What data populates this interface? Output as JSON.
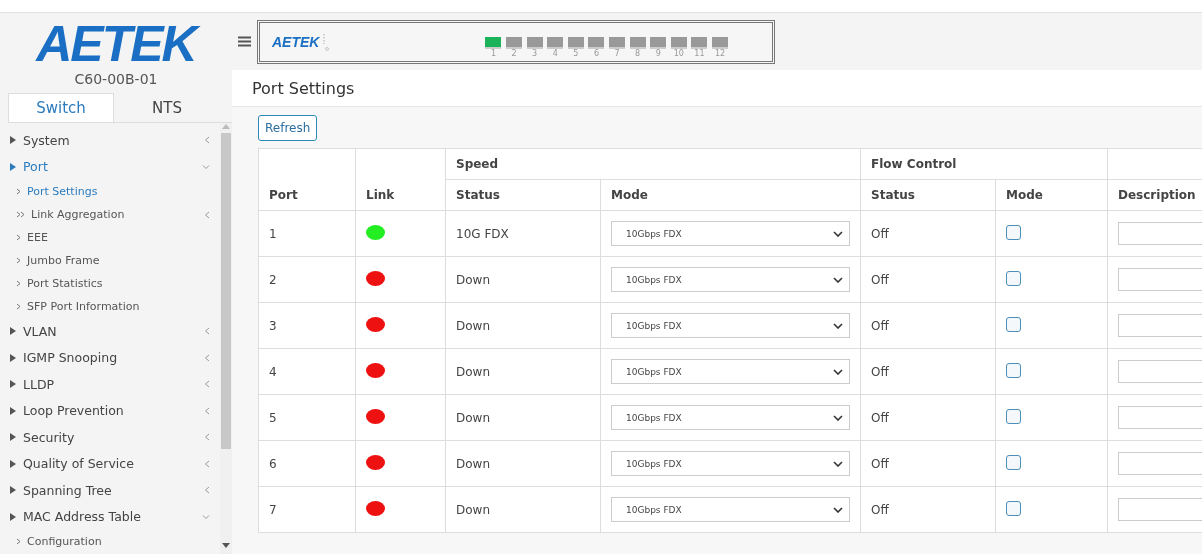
{
  "logo": "AETEK",
  "model": "C60-00B-01",
  "tabs": [
    {
      "label": "Switch",
      "selected": true
    },
    {
      "label": "NTS",
      "selected": false
    }
  ],
  "menu": [
    {
      "label": "System",
      "expanded": false,
      "selected": false
    },
    {
      "label": "Port",
      "expanded": true,
      "selected": true,
      "children": [
        {
          "label": "Port Settings",
          "selected": true
        },
        {
          "label": "Link Aggregation",
          "selected": false,
          "expanded": false
        },
        {
          "label": "EEE",
          "selected": false
        },
        {
          "label": "Jumbo Frame",
          "selected": false
        },
        {
          "label": "Port Statistics",
          "selected": false
        },
        {
          "label": "SFP Port Information",
          "selected": false
        }
      ]
    },
    {
      "label": "VLAN",
      "expanded": false,
      "selected": false
    },
    {
      "label": "IGMP Snooping",
      "expanded": false,
      "selected": false
    },
    {
      "label": "LLDP",
      "expanded": false,
      "selected": false
    },
    {
      "label": "Loop Prevention",
      "expanded": false,
      "selected": false
    },
    {
      "label": "Security",
      "expanded": false,
      "selected": false
    },
    {
      "label": "Quality of Service",
      "expanded": false,
      "selected": false
    },
    {
      "label": "Spanning Tree",
      "expanded": false,
      "selected": false
    },
    {
      "label": "MAC Address Table",
      "expanded": true,
      "selected": false,
      "children": [
        {
          "label": "Configuration",
          "selected": false
        }
      ]
    }
  ],
  "device": {
    "logo": "AETEK",
    "ports": [
      {
        "label": "1",
        "on": true
      },
      {
        "label": "2",
        "on": false
      },
      {
        "label": "3",
        "on": false
      },
      {
        "label": "4",
        "on": false
      },
      {
        "label": "5",
        "on": false
      },
      {
        "label": "6",
        "on": false
      },
      {
        "label": "7",
        "on": false
      },
      {
        "label": "8",
        "on": false
      },
      {
        "label": "9",
        "on": false
      },
      {
        "label": "10",
        "on": false
      },
      {
        "label": "11",
        "on": false
      },
      {
        "label": "12",
        "on": false
      }
    ]
  },
  "page": {
    "title": "Port Settings",
    "refresh": "Refresh"
  },
  "table": {
    "group_headers": [
      "Speed",
      "Flow Control"
    ],
    "columns": [
      "Port",
      "Link",
      "Status",
      "Mode",
      "Status",
      "Mode",
      "Description"
    ],
    "rows": [
      {
        "port": "1",
        "color": "#22ee22",
        "speed_status": "10G FDX",
        "speed_mode": "10Gbps FDX",
        "fc_status": "Off",
        "fc_mode": false
      },
      {
        "port": "2",
        "color": "#ee1111",
        "speed_status": "Down",
        "speed_mode": "10Gbps FDX",
        "fc_status": "Off",
        "fc_mode": false
      },
      {
        "port": "3",
        "color": "#ee1111",
        "speed_status": "Down",
        "speed_mode": "10Gbps FDX",
        "fc_status": "Off",
        "fc_mode": false
      },
      {
        "port": "4",
        "color": "#ee1111",
        "speed_status": "Down",
        "speed_mode": "10Gbps FDX",
        "fc_status": "Off",
        "fc_mode": false
      },
      {
        "port": "5",
        "color": "#ee1111",
        "speed_status": "Down",
        "speed_mode": "10Gbps FDX",
        "fc_status": "Off",
        "fc_mode": false
      },
      {
        "port": "6",
        "color": "#ee1111",
        "speed_status": "Down",
        "speed_mode": "10Gbps FDX",
        "fc_status": "Off",
        "fc_mode": false
      },
      {
        "port": "7",
        "color": "#ee1111",
        "speed_status": "Down",
        "speed_mode": "10Gbps FDX",
        "fc_status": "Off",
        "fc_mode": false
      }
    ]
  }
}
